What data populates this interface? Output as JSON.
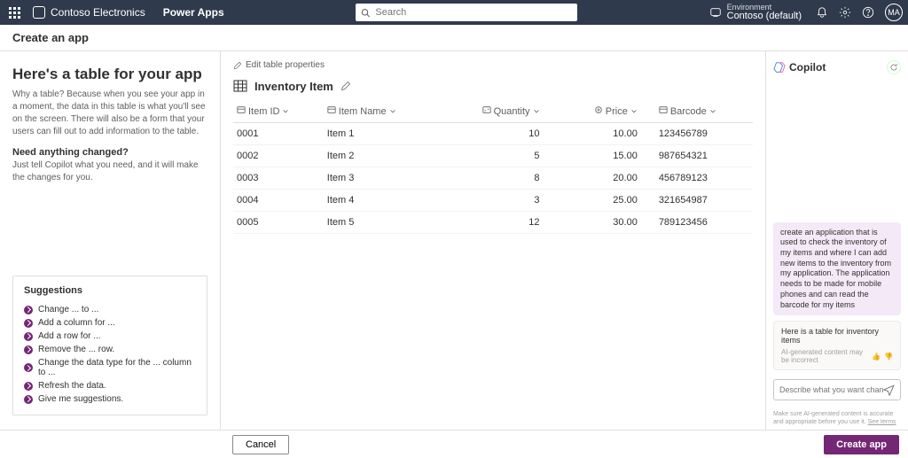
{
  "header": {
    "brand": "Contoso Electronics",
    "app_name": "Power Apps",
    "search_placeholder": "Search",
    "env_label": "Environment",
    "env_value": "Contoso (default)",
    "avatar_initials": "MA"
  },
  "subhead": {
    "title": "Create an app"
  },
  "left": {
    "heading": "Here's a table for your app",
    "paragraph": "Why a table? Because when you see your app in a moment, the data in this table is what you'll see on the screen. There will also be a form that your users can fill out to add information to the table.",
    "need_heading": "Need anything changed?",
    "need_text": "Just tell Copilot what you need, and it will make the changes for you.",
    "suggestions_title": "Suggestions",
    "suggestions": [
      "Change ... to ...",
      "Add a column for ...",
      "Add a row for ...",
      "Remove the ... row.",
      "Change the data type for the ... column to ...",
      "Refresh the data.",
      "Give me suggestions."
    ]
  },
  "center": {
    "edit_link": "Edit table properties",
    "table_title": "Inventory Item",
    "columns": [
      "Item ID",
      "Item Name",
      "Quantity",
      "Price",
      "Barcode"
    ],
    "rows": [
      {
        "id": "0001",
        "name": "Item 1",
        "qty": "10",
        "price": "10.00",
        "barcode": "123456789"
      },
      {
        "id": "0002",
        "name": "Item 2",
        "qty": "5",
        "price": "15.00",
        "barcode": "987654321"
      },
      {
        "id": "0003",
        "name": "Item 3",
        "qty": "8",
        "price": "20.00",
        "barcode": "456789123"
      },
      {
        "id": "0004",
        "name": "Item 4",
        "qty": "3",
        "price": "25.00",
        "barcode": "321654987"
      },
      {
        "id": "0005",
        "name": "Item 5",
        "qty": "12",
        "price": "30.00",
        "barcode": "789123456"
      }
    ]
  },
  "copilot": {
    "title": "Copilot",
    "user_message": "create an application that is used to check the inventory of my items and where I can add new items to the inventory from my application. The application needs to be made for mobile phones and can read the barcode for my items",
    "bot_message": "Here is a table for inventory items",
    "bot_footer": "AI-generated content may be incorrect",
    "input_placeholder": "Describe what you want changed...",
    "disclaimer_text": "Make sure AI-generated content is accurate and appropriate before you use it.",
    "disclaimer_link": "See terms"
  },
  "footer": {
    "cancel": "Cancel",
    "create": "Create app"
  }
}
